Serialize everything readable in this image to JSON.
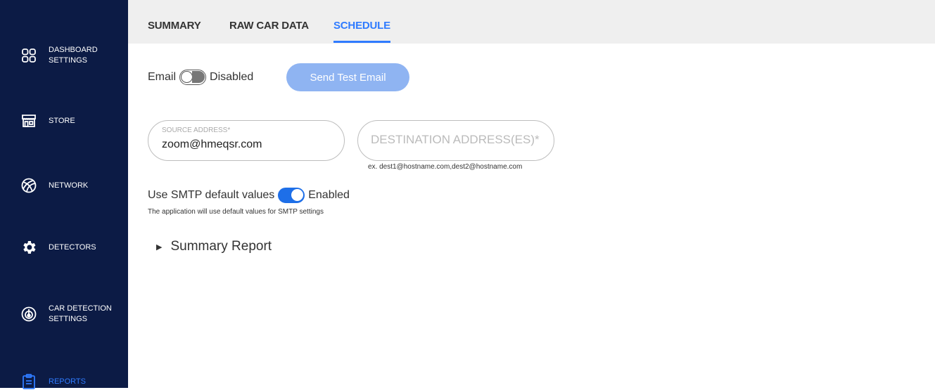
{
  "sidebar": {
    "items": [
      {
        "label_line1": "DASHBOARD",
        "label_line2": "SETTINGS",
        "icon": "dashboard-grid-icon"
      },
      {
        "label": "STORE",
        "icon": "store-icon"
      },
      {
        "label": "NETWORK",
        "icon": "network-icon"
      },
      {
        "label": "DETECTORS",
        "icon": "gear-icon"
      },
      {
        "label_line1": "CAR DETECTION",
        "label_line2": "SETTINGS",
        "icon": "radar-icon"
      },
      {
        "label": "REPORTS",
        "icon": "clipboard-icon",
        "active": true
      }
    ]
  },
  "tabs": {
    "summary": "SUMMARY",
    "raw": "RAW CAR DATA",
    "schedule": "SCHEDULE",
    "active": "SCHEDULE"
  },
  "email": {
    "label": "Email",
    "state": "Disabled",
    "send_test_label": "Send Test Email"
  },
  "source": {
    "label": "SOURCE ADDRESS*",
    "value": "zoom@hmeqsr.com"
  },
  "destination": {
    "placeholder": "DESTINATION ADDRESS(ES)*",
    "hint": "ex. dest1@hostname.com,dest2@hostname.com"
  },
  "smtp": {
    "label": "Use SMTP default values",
    "state": "Enabled",
    "note": "The application will use default values for SMTP settings"
  },
  "summary_report": {
    "label": "Summary Report"
  },
  "colors": {
    "sidebar_bg": "#0c1b45",
    "accent": "#2f7bff",
    "button_disabled": "#8fb4f2"
  }
}
